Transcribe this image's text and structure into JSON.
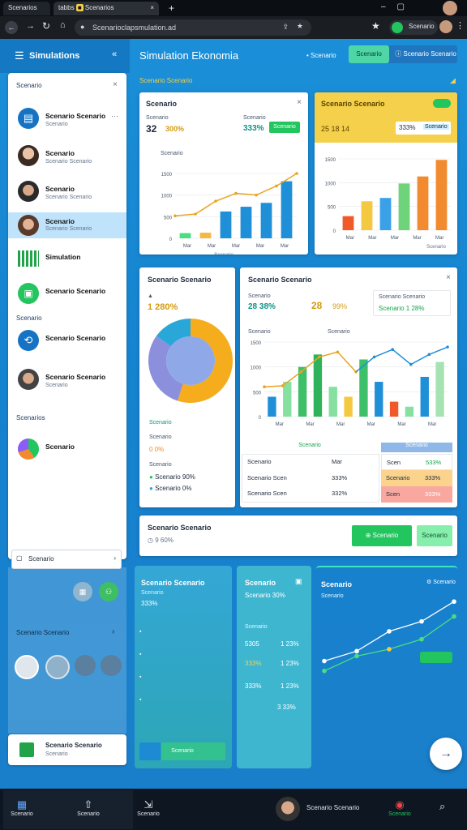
{
  "browser": {
    "tabs": [
      {
        "label": "Scenarios"
      },
      {
        "label": "tabbs"
      },
      {
        "label": "Scenarios"
      }
    ],
    "new_tab": "+",
    "url": "Scenarioclapsmulation.ad",
    "profile": "Scenario"
  },
  "sidebar": {
    "title": "Simulations",
    "search_label": "Scenario",
    "items": [
      {
        "title": "Scenario Scenario",
        "subtitle": "Scenario"
      },
      {
        "title": "Scenario",
        "subtitle": "Scenario Scenario"
      },
      {
        "title": "Scenario",
        "subtitle": "Scenario Scenario"
      },
      {
        "title": "Scenario",
        "subtitle": "Scenario Scenario"
      },
      {
        "title": "Simulation"
      },
      {
        "title": "Scenario Scenario"
      }
    ],
    "section1": "Scenario",
    "items2": [
      {
        "title": "Scenario Scenario"
      },
      {
        "title": "Scenario Scenario",
        "subtitle": "Scenario"
      }
    ],
    "section2": "Scenarios",
    "items3": [
      {
        "title": "Scenario"
      }
    ],
    "select_label": "Scenario",
    "section3": "Scenario Scenario",
    "footer": {
      "title": "Scenario Scenario",
      "subtitle": "Scenario"
    }
  },
  "header": {
    "title": "Simulation Ekonomia",
    "link": "Scenario",
    "tab1": "Scenario",
    "tab2": "Scenario Scenario"
  },
  "filter_label": "Scenario Scenario",
  "card1": {
    "title": "Scenario",
    "stat1_label": "Scenario",
    "stat1_value": "32",
    "stat1_pct": "300%",
    "stat2_label": "Scenario",
    "stat2_value": "333%",
    "btn": "Scenario",
    "ylabel": "Scenario",
    "xcaption": "Scenario",
    "ticks_y": [
      "1500",
      "1000",
      "500",
      "0"
    ],
    "ticks_x": [
      "Mar",
      "Mar",
      "Mar",
      "Mar",
      "Mar"
    ]
  },
  "card2": {
    "title": "Scenario Scenario",
    "stat1_value": "25 18 14",
    "stat2_value": "333%",
    "btn": "Scenario",
    "ticks_y": [
      "1500",
      "1000",
      "500",
      "0"
    ],
    "ticks_x": [
      "Mar",
      "Mar",
      "Mar",
      "Mar",
      "Mar"
    ],
    "xcaption": "Scenario"
  },
  "card3": {
    "title": "Scenario Scenario",
    "value": "1 280%",
    "leg1": "Scenario",
    "leg1_value": "0 0%",
    "leg2": "Scenario",
    "leg2_value": "Scenario 90%",
    "leg3_value": "Scenario 0%",
    "pie_label": "Scenario"
  },
  "card4": {
    "title": "Scenario Scenario",
    "stat1_label": "Scenario",
    "stat1_value": "28 38%",
    "stat2_value": "28",
    "stat2_pct": "99%",
    "stat3_label": "Scenario Scenario",
    "stat3_value": "Scenario 1 28%",
    "ticks_y": [
      "1500",
      "1000",
      "500",
      "0"
    ],
    "ticks_x": [
      "Mar",
      "Mar",
      "Mar",
      "Mar",
      "Mar",
      "Mar"
    ],
    "ylabel": "Scenario",
    "ylabel2": "Scenario",
    "table_header": "Scenario",
    "table_header2": "Scenario",
    "rows": [
      {
        "name": "Scenario",
        "val": "Mar",
        "name2": "Scen",
        "val2": "533%"
      },
      {
        "name": "Scenario Scen",
        "val": "333%",
        "name2": "Scenario",
        "val2": "333%"
      },
      {
        "name": "Scenario Scen",
        "val": "332%",
        "name2": "Scen",
        "val2": "333%"
      }
    ]
  },
  "card5": {
    "title": "Scenario Scenario",
    "value": "9 60%",
    "btn1": "Scenario",
    "btn2": "Scenario"
  },
  "bottom1": {
    "title": "Scenario Scenario",
    "sub": "Scenario",
    "value": "333%",
    "btn": "Scenario"
  },
  "bottom2": {
    "title": "Scenario",
    "sub": "Scenario 30%",
    "rows": [
      {
        "a": "Scenario",
        "b": ""
      },
      {
        "a": "5305",
        "b": "1 23%"
      },
      {
        "a": "333%",
        "b": "1 23%"
      },
      {
        "a": "333%",
        "b": "1 23%"
      },
      {
        "a": "",
        "b": "3 33%"
      }
    ]
  },
  "bottom3": {
    "title": "Scenario",
    "sub": "Scenario",
    "right": "Scenario"
  },
  "taskbar": {
    "items": [
      "Scenario",
      "Scenario",
      "Scenario"
    ],
    "profile": "Scenario Scenario",
    "right": "Scenario"
  },
  "chart_data": [
    {
      "type": "bar",
      "title": "Scenario",
      "ylim": [
        0,
        1500
      ],
      "categories": [
        "Mar",
        "Mar",
        "Mar",
        "Mar",
        "Mar",
        "Mar",
        "Mar"
      ],
      "series": [
        {
          "values": [
            120,
            130,
            620,
            730,
            820,
            1320
          ]
        },
        {
          "values": [
            520,
            560,
            860,
            1040,
            1000,
            1210,
            1500
          ]
        }
      ]
    },
    {
      "type": "bar",
      "title": "Scenario Scenario",
      "ylim": [
        0,
        1500
      ],
      "categories": [
        "Mar",
        "Mar",
        "Mar",
        "Mar",
        "Mar",
        "Mar"
      ],
      "series": [
        {
          "values": [
            340,
            700,
            780,
            1130,
            1300,
            1700
          ]
        }
      ]
    },
    {
      "type": "pie",
      "title": "Scenario Scenario",
      "values": [
        55,
        30,
        15
      ],
      "colors": [
        "#f6ad1d",
        "#8b8fdc",
        "#2aa7d9"
      ]
    },
    {
      "type": "bar",
      "title": "Scenario Scenario",
      "ylim": [
        0,
        1500
      ],
      "categories": [
        "Mar",
        "Mar",
        "Mar",
        "Mar",
        "Mar",
        "Mar"
      ],
      "series": [
        {
          "values": [
            400,
            700,
            1000,
            1250,
            600,
            400,
            1150,
            700,
            300,
            200,
            800,
            1100
          ]
        },
        {
          "values": [
            600,
            620,
            900,
            1200,
            1300,
            900,
            1200,
            1350,
            1050,
            1250,
            1400
          ]
        }
      ]
    },
    {
      "type": "line",
      "title": "Scenario",
      "series": [
        {
          "values": [
            2,
            3,
            5,
            6,
            8
          ]
        },
        {
          "values": [
            1,
            2.5,
            3.2,
            4.2,
            6.5
          ]
        }
      ]
    }
  ],
  "colors": {
    "accent": "#1a8fd8",
    "green": "#22c55e",
    "yellow": "#f5d04a",
    "orange": "#f28b30"
  }
}
